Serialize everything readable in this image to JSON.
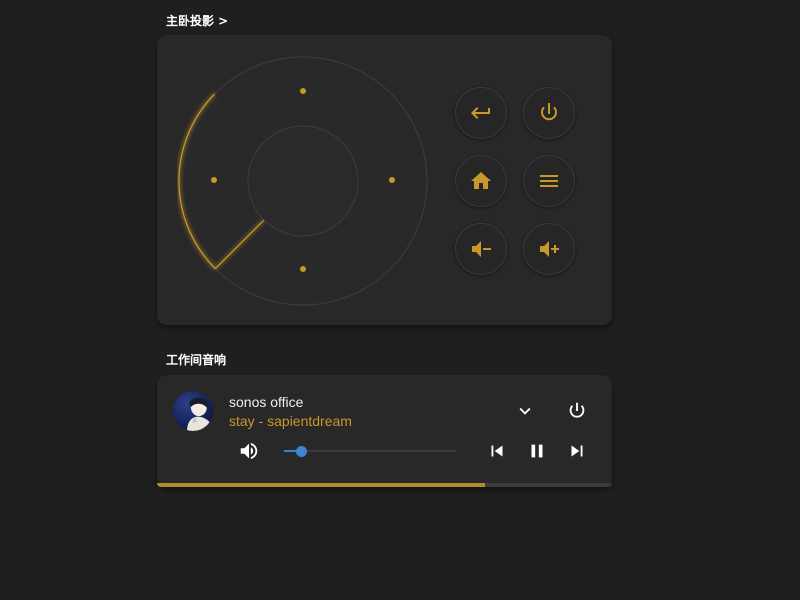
{
  "remote": {
    "title": "主卧投影 >",
    "accent": "#c8982c",
    "dpad": [
      "up",
      "left",
      "right",
      "down",
      "ok"
    ],
    "buttons": [
      {
        "name": "back",
        "icon": "return-icon"
      },
      {
        "name": "power",
        "icon": "power-icon"
      },
      {
        "name": "home",
        "icon": "home-icon"
      },
      {
        "name": "menu",
        "icon": "menu-icon"
      },
      {
        "name": "volume-down",
        "icon": "volume-minus-icon"
      },
      {
        "name": "volume-up",
        "icon": "volume-plus-icon"
      }
    ]
  },
  "speaker": {
    "title": "工作间音响",
    "player_name": "sonos office",
    "track": "stay - sapientdream",
    "volume_percent": 10,
    "progress_percent": 72,
    "volume_color": "#3d85d1",
    "progress_color": "#b28a2a"
  }
}
